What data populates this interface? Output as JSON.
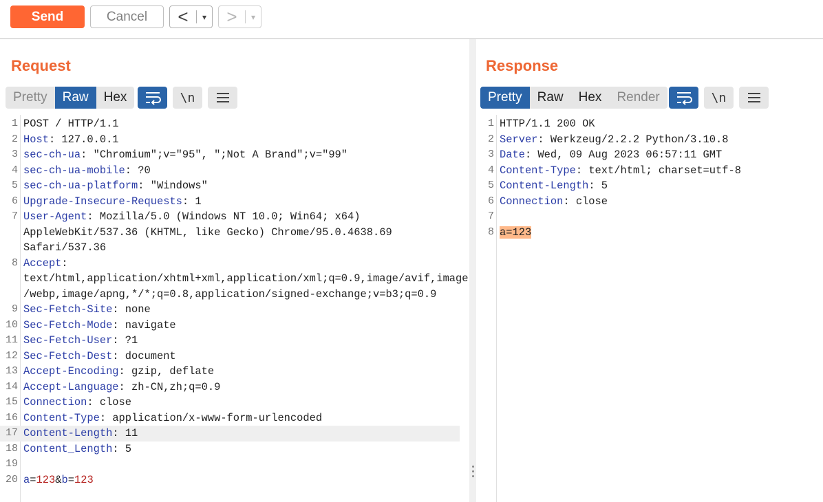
{
  "toolbar": {
    "send_label": "Send",
    "cancel_label": "Cancel",
    "back_label": "<",
    "forward_label": ">",
    "dropdown_glyph": "▾"
  },
  "request": {
    "title": "Request",
    "tabs": [
      "Pretty",
      "Raw",
      "Hex"
    ],
    "active_tab": "Raw",
    "newline_label": "\\n",
    "lines": [
      {
        "n": "1",
        "parts": [
          {
            "t": "POST / HTTP/1.1",
            "c": ""
          }
        ]
      },
      {
        "n": "2",
        "parts": [
          {
            "t": "Host",
            "c": "key"
          },
          {
            "t": ": 127.0.0.1",
            "c": ""
          }
        ]
      },
      {
        "n": "3",
        "parts": [
          {
            "t": "sec-ch-ua",
            "c": "key"
          },
          {
            "t": ": \"Chromium\";v=\"95\", \";Not A Brand\";v=\"99\"",
            "c": ""
          }
        ]
      },
      {
        "n": "4",
        "parts": [
          {
            "t": "sec-ch-ua-mobile",
            "c": "key"
          },
          {
            "t": ": ?0",
            "c": ""
          }
        ]
      },
      {
        "n": "5",
        "parts": [
          {
            "t": "sec-ch-ua-platform",
            "c": "key"
          },
          {
            "t": ": \"Windows\"",
            "c": ""
          }
        ]
      },
      {
        "n": "6",
        "parts": [
          {
            "t": "Upgrade-Insecure-Requests",
            "c": "key"
          },
          {
            "t": ": 1",
            "c": ""
          }
        ]
      },
      {
        "n": "7",
        "parts": [
          {
            "t": "User-Agent",
            "c": "key"
          },
          {
            "t": ": Mozilla/5.0 (Windows NT 10.0; Win64; x64)",
            "c": ""
          }
        ]
      },
      {
        "n": "",
        "parts": [
          {
            "t": "AppleWebKit/537.36 (KHTML, like Gecko) Chrome/95.0.4638.69",
            "c": ""
          }
        ]
      },
      {
        "n": "",
        "parts": [
          {
            "t": "Safari/537.36",
            "c": ""
          }
        ]
      },
      {
        "n": "8",
        "parts": [
          {
            "t": "Accept",
            "c": "key"
          },
          {
            "t": ":",
            "c": ""
          }
        ]
      },
      {
        "n": "",
        "parts": [
          {
            "t": "text/html,application/xhtml+xml,application/xml;q=0.9,image/avif,image",
            "c": ""
          }
        ]
      },
      {
        "n": "",
        "parts": [
          {
            "t": "/webp,image/apng,*/*;q=0.8,application/signed-exchange;v=b3;q=0.9",
            "c": ""
          }
        ]
      },
      {
        "n": "9",
        "parts": [
          {
            "t": "Sec-Fetch-Site",
            "c": "key"
          },
          {
            "t": ": none",
            "c": ""
          }
        ]
      },
      {
        "n": "10",
        "parts": [
          {
            "t": "Sec-Fetch-Mode",
            "c": "key"
          },
          {
            "t": ": navigate",
            "c": ""
          }
        ]
      },
      {
        "n": "11",
        "parts": [
          {
            "t": "Sec-Fetch-User",
            "c": "key"
          },
          {
            "t": ": ?1",
            "c": ""
          }
        ]
      },
      {
        "n": "12",
        "parts": [
          {
            "t": "Sec-Fetch-Dest",
            "c": "key"
          },
          {
            "t": ": document",
            "c": ""
          }
        ]
      },
      {
        "n": "13",
        "parts": [
          {
            "t": "Accept-Encoding",
            "c": "key"
          },
          {
            "t": ": gzip, deflate",
            "c": ""
          }
        ]
      },
      {
        "n": "14",
        "parts": [
          {
            "t": "Accept-Language",
            "c": "key"
          },
          {
            "t": ": zh-CN,zh;q=0.9",
            "c": ""
          }
        ]
      },
      {
        "n": "15",
        "parts": [
          {
            "t": "Connection",
            "c": "key"
          },
          {
            "t": ": close",
            "c": ""
          }
        ]
      },
      {
        "n": "16",
        "parts": [
          {
            "t": "Content-Type",
            "c": "key"
          },
          {
            "t": ": application/x-www-form-urlencoded",
            "c": ""
          }
        ]
      },
      {
        "n": "17",
        "hl": true,
        "parts": [
          {
            "t": "Content-Length",
            "c": "key"
          },
          {
            "t": ": 11",
            "c": ""
          }
        ]
      },
      {
        "n": "18",
        "parts": [
          {
            "t": "Content_Length",
            "c": "key"
          },
          {
            "t": ": 5",
            "c": ""
          }
        ]
      },
      {
        "n": "19",
        "parts": [
          {
            "t": "",
            "c": ""
          }
        ]
      },
      {
        "n": "20",
        "parts": [
          {
            "t": "a",
            "c": "pk"
          },
          {
            "t": "=",
            "c": ""
          },
          {
            "t": "123",
            "c": "pv"
          },
          {
            "t": "&",
            "c": "amp"
          },
          {
            "t": "b",
            "c": "pk"
          },
          {
            "t": "=",
            "c": ""
          },
          {
            "t": "123",
            "c": "pv"
          }
        ]
      }
    ]
  },
  "response": {
    "title": "Response",
    "tabs": [
      "Pretty",
      "Raw",
      "Hex",
      "Render"
    ],
    "active_tab": "Pretty",
    "newline_label": "\\n",
    "lines": [
      {
        "n": "1",
        "parts": [
          {
            "t": "HTTP/1.1 200 OK",
            "c": ""
          }
        ]
      },
      {
        "n": "2",
        "parts": [
          {
            "t": "Server",
            "c": "key"
          },
          {
            "t": ": Werkzeug/2.2.2 Python/3.10.8",
            "c": ""
          }
        ]
      },
      {
        "n": "3",
        "parts": [
          {
            "t": "Date",
            "c": "key"
          },
          {
            "t": ": Wed, 09 Aug 2023 06:57:11 GMT",
            "c": ""
          }
        ]
      },
      {
        "n": "4",
        "parts": [
          {
            "t": "Content-Type",
            "c": "key"
          },
          {
            "t": ": text/html; charset=utf-8",
            "c": ""
          }
        ]
      },
      {
        "n": "5",
        "parts": [
          {
            "t": "Content-Length",
            "c": "key"
          },
          {
            "t": ": 5",
            "c": ""
          }
        ]
      },
      {
        "n": "6",
        "parts": [
          {
            "t": "Connection",
            "c": "key"
          },
          {
            "t": ": close",
            "c": ""
          }
        ]
      },
      {
        "n": "7",
        "parts": [
          {
            "t": "",
            "c": ""
          }
        ]
      },
      {
        "n": "8",
        "parts": [
          {
            "t": "a=123",
            "c": "match"
          }
        ]
      }
    ]
  },
  "colors": {
    "accent": "#ff6633",
    "tab_active": "#2a64a8",
    "header_key": "#2c3ea7",
    "param_value": "#b5211e",
    "highlight": "#ffb98a"
  }
}
